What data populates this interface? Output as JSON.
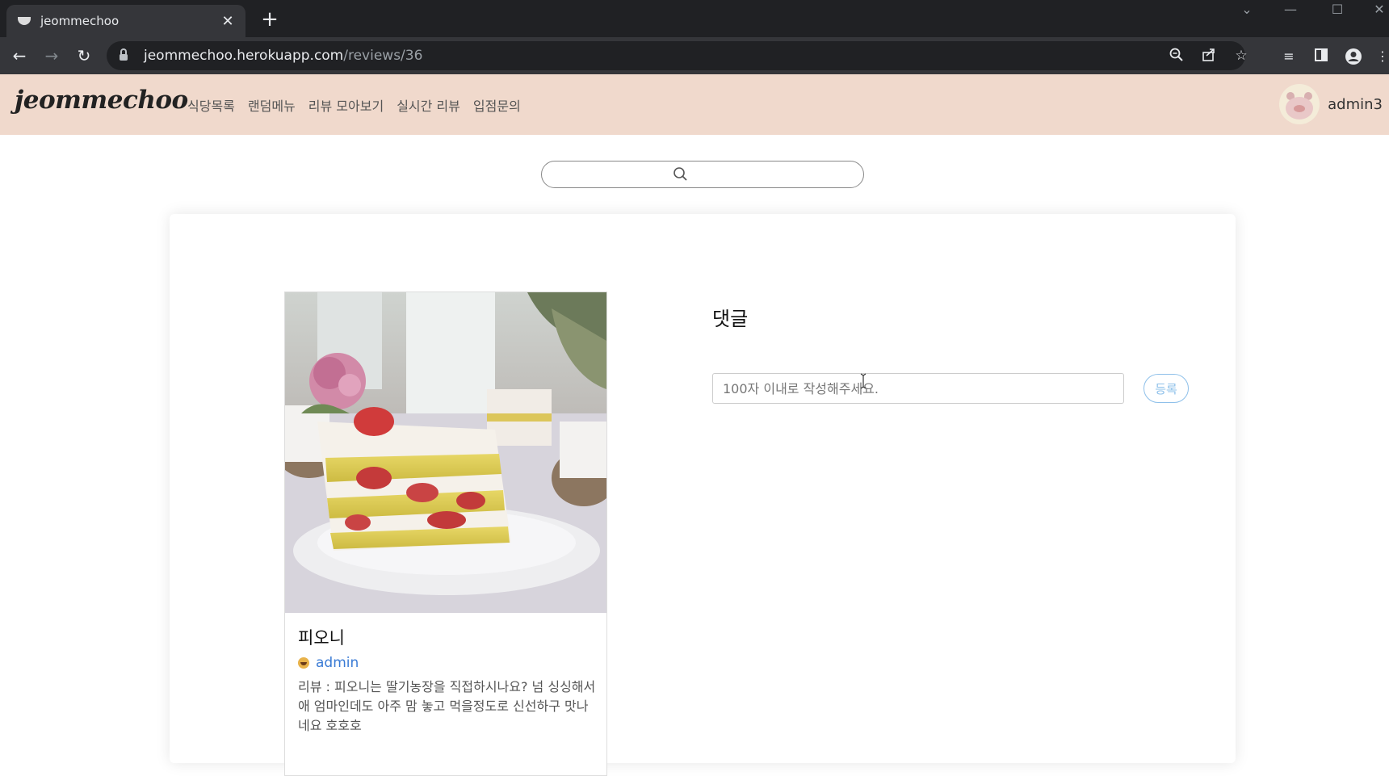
{
  "browser": {
    "tab_title": "jeommechoo",
    "tab_close": "✕",
    "new_tab": "+",
    "url_host": "jeommechoo.herokuapp.com",
    "url_path": "/reviews/36"
  },
  "header": {
    "logo": "jeommechoo",
    "nav": [
      {
        "label": "식당목록"
      },
      {
        "label": "랜덤메뉴"
      },
      {
        "label": "리뷰 모아보기"
      },
      {
        "label": "실시간 리뷰"
      },
      {
        "label": "입점문의"
      }
    ],
    "username": "admin3"
  },
  "search": {
    "placeholder": ""
  },
  "review": {
    "place_name": "피오니",
    "author": "admin",
    "text": "리뷰 : 피오니는 딸기농장을 직접하시나요? 넘 싱싱해서 애 엄마인데도 아주 맘 놓고 먹을정도로 신선하구 맛나네요 호호호"
  },
  "comments": {
    "title": "댓글",
    "input_placeholder": "100자 이내로 작성해주세요.",
    "submit_label": "등록"
  },
  "colors": {
    "header_bg": "#f0d9cc",
    "link": "#3a7bd5",
    "submit_accent": "#8ec0ea"
  }
}
